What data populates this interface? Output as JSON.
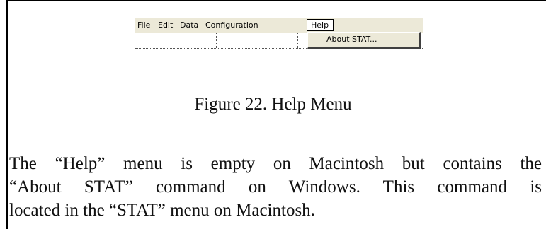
{
  "menubar": {
    "items": [
      "File",
      "Edit",
      "Data",
      "Configuration"
    ],
    "active_menu": "Help"
  },
  "dropdown": {
    "items": [
      "About STAT..."
    ]
  },
  "caption": "Figure 22.  Help Menu",
  "body": {
    "lines": [
      "The “Help” menu is empty on Macintosh but contains the",
      "“About STAT” command on Windows. This command is",
      "located in the “STAT” menu on Macintosh."
    ]
  }
}
